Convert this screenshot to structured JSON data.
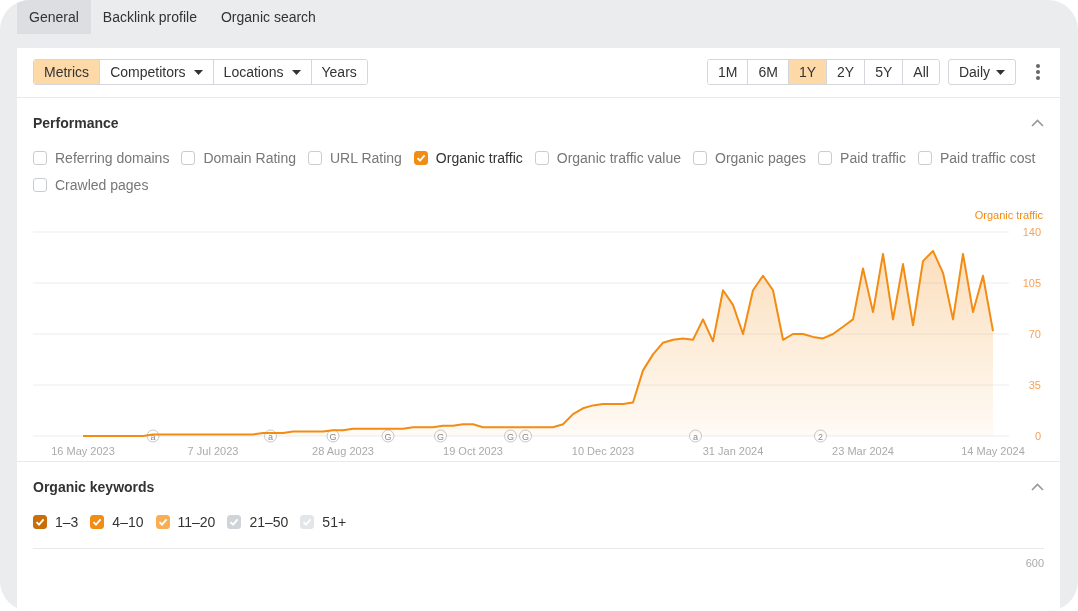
{
  "tabs": [
    {
      "label": "General",
      "selected": true
    },
    {
      "label": "Backlink profile",
      "selected": false
    },
    {
      "label": "Organic search",
      "selected": false
    }
  ],
  "toolbar": {
    "views": [
      {
        "label": "Metrics",
        "selected": true,
        "dropdown": false
      },
      {
        "label": "Competitors",
        "selected": false,
        "dropdown": true
      },
      {
        "label": "Locations",
        "selected": false,
        "dropdown": true
      },
      {
        "label": "Years",
        "selected": false,
        "dropdown": false
      }
    ],
    "ranges": [
      {
        "label": "1M",
        "selected": false
      },
      {
        "label": "6M",
        "selected": false
      },
      {
        "label": "1Y",
        "selected": true
      },
      {
        "label": "2Y",
        "selected": false
      },
      {
        "label": "5Y",
        "selected": false
      },
      {
        "label": "All",
        "selected": false
      }
    ],
    "interval": {
      "label": "Daily"
    }
  },
  "performance": {
    "title": "Performance",
    "expanded": true,
    "metrics": [
      {
        "label": "Referring domains",
        "checked": false
      },
      {
        "label": "Domain Rating",
        "checked": false
      },
      {
        "label": "URL Rating",
        "checked": false
      },
      {
        "label": "Organic traffic",
        "checked": true
      },
      {
        "label": "Organic traffic value",
        "checked": false
      },
      {
        "label": "Organic pages",
        "checked": false
      },
      {
        "label": "Paid traffic",
        "checked": false
      },
      {
        "label": "Paid traffic cost",
        "checked": false
      },
      {
        "label": "Crawled pages",
        "checked": false
      }
    ],
    "chart_data": {
      "type": "area",
      "categories": [
        "16 May 2023",
        null,
        null,
        null,
        null,
        null,
        null,
        null,
        null,
        null,
        null,
        null,
        null,
        "7 Jul 2023",
        null,
        null,
        null,
        null,
        null,
        null,
        null,
        null,
        null,
        null,
        null,
        null,
        "28 Aug 2023",
        null,
        null,
        null,
        null,
        null,
        null,
        null,
        null,
        null,
        null,
        null,
        null,
        "19 Oct 2023",
        null,
        null,
        null,
        null,
        null,
        null,
        null,
        null,
        null,
        null,
        null,
        null,
        "10 Dec 2023",
        null,
        null,
        null,
        null,
        null,
        null,
        null,
        null,
        null,
        null,
        null,
        null,
        "31 Jan 2024",
        null,
        null,
        null,
        null,
        null,
        null,
        null,
        null,
        null,
        null,
        null,
        null,
        "23 Mar 2024",
        null,
        null,
        null,
        null,
        null,
        null,
        null,
        null,
        null,
        null,
        null,
        null,
        "14 May 2024"
      ],
      "series": [
        {
          "name": "Organic traffic",
          "color": "#f28c13",
          "values": [
            0,
            0,
            0,
            0,
            0,
            0,
            0,
            1,
            1,
            1,
            1,
            1,
            1,
            1,
            1,
            1,
            1,
            1,
            2,
            2,
            2,
            3,
            3,
            3,
            3,
            4,
            4,
            5,
            5,
            5,
            5,
            5,
            5,
            6,
            6,
            6,
            7,
            7,
            8,
            8,
            6,
            6,
            6,
            6,
            6,
            6,
            6,
            6,
            8,
            15,
            19,
            21,
            22,
            22,
            22,
            23,
            45,
            56,
            64,
            66,
            67,
            66,
            80,
            65,
            100,
            90,
            70,
            100,
            110,
            100,
            66,
            70,
            70,
            68,
            67,
            70,
            75,
            80,
            115,
            85,
            125,
            80,
            118,
            76,
            120,
            127,
            112,
            80,
            125,
            85,
            110,
            72
          ]
        }
      ],
      "ylim": [
        0,
        140
      ],
      "grid": true,
      "yticks": [
        0,
        35,
        70,
        105,
        140
      ],
      "annotations": [
        {
          "text": "a"
        },
        {
          "text": "a"
        },
        {
          "text": "G"
        },
        {
          "text": "G"
        },
        {
          "text": "G"
        },
        {
          "text": "G"
        },
        {
          "text": "G"
        },
        {
          "text": "a"
        },
        {
          "text": "2"
        }
      ]
    }
  },
  "organic_keywords": {
    "title": "Organic keywords",
    "expanded": true,
    "ranges": [
      {
        "label": "1–3",
        "checked": true,
        "color": "#c86f0c"
      },
      {
        "label": "4–10",
        "checked": true,
        "color": "#f28c13"
      },
      {
        "label": "11–20",
        "checked": true,
        "color": "#f9ae55"
      },
      {
        "label": "21–50",
        "checked": true,
        "color": "#cfd4d9"
      },
      {
        "label": "51+",
        "checked": true,
        "color": "#e3e6e9"
      }
    ],
    "y_tick": "600"
  }
}
